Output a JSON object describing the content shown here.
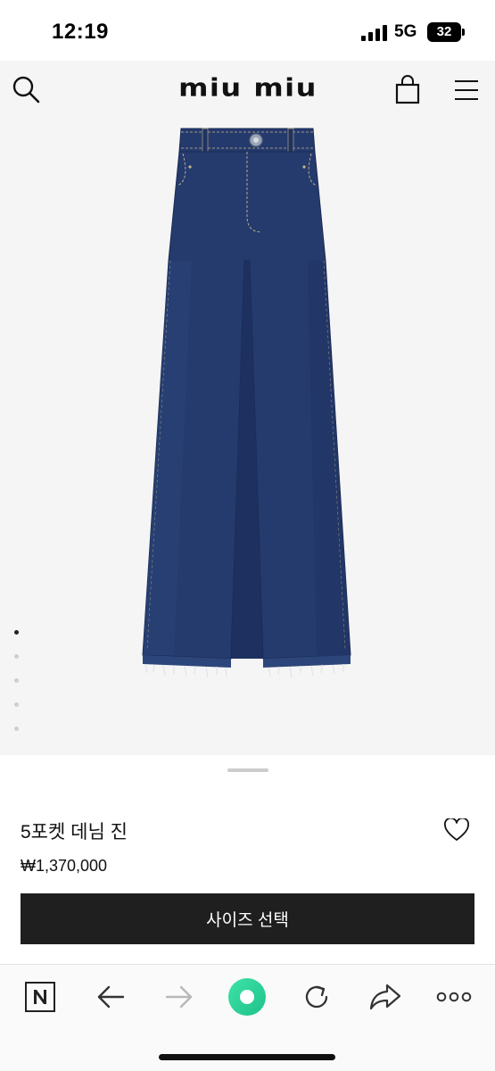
{
  "status_bar": {
    "time": "12:19",
    "network": "5G",
    "battery": "32"
  },
  "header": {
    "brand": "miu miu",
    "icons": {
      "search": "search-icon",
      "bag": "shopping-bag-icon",
      "menu": "hamburger-menu-icon"
    }
  },
  "gallery": {
    "image": "denim-jeans-product-image",
    "dots_total": 5,
    "active_index": 0
  },
  "product": {
    "name": "5포켓 데님 진",
    "price": "₩1,370,000",
    "size_button_label": "사이즈 선택",
    "wishlist_icon": "heart-icon"
  },
  "browser_toolbar": {
    "items": [
      "naver-icon",
      "back-arrow-icon",
      "forward-arrow-icon",
      "green-dot-icon",
      "reload-icon",
      "share-icon",
      "more-icon"
    ],
    "accent": "#2ed49a"
  },
  "colors": {
    "denim": "#253b6e",
    "button_bg": "#1f1f1f",
    "header_bg": "#f5f5f5"
  }
}
